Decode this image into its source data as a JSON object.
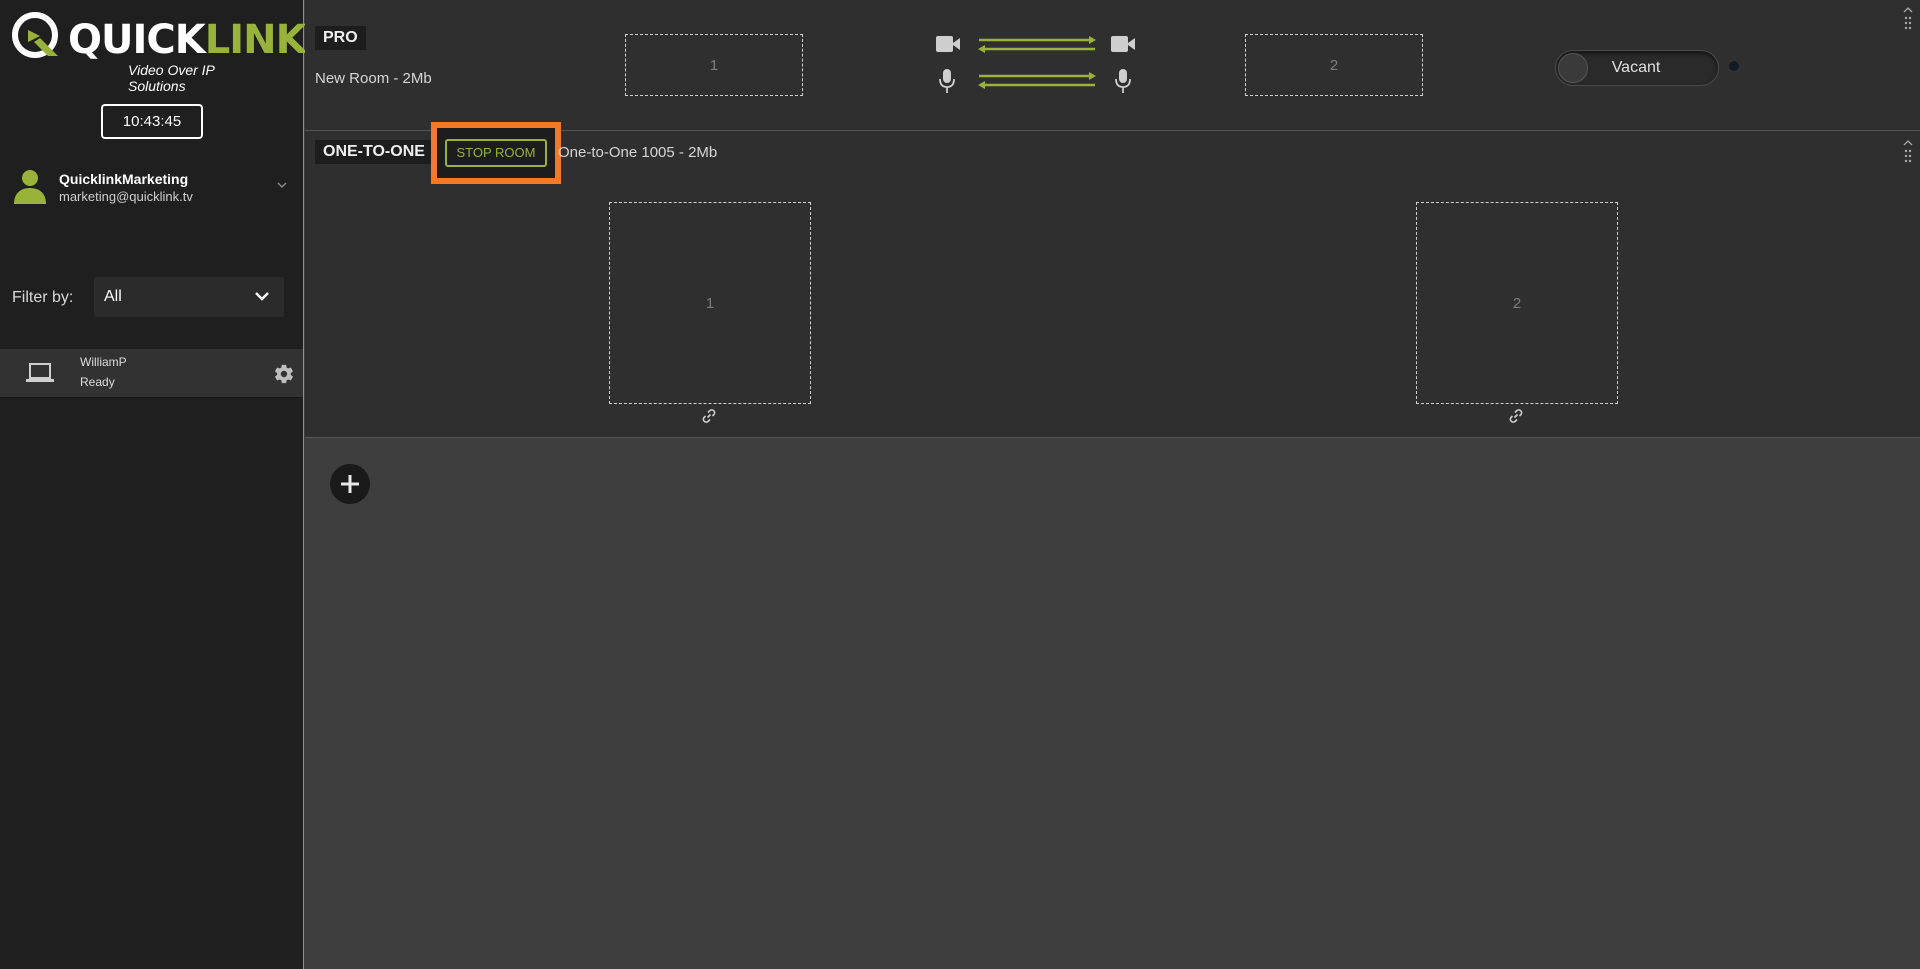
{
  "brand": {
    "name_part1": "QUICK",
    "name_part2": "LINK",
    "tagline": "Video Over IP Solutions",
    "accent_color": "#99b23a"
  },
  "clock": {
    "time": "10:43:45"
  },
  "user": {
    "name": "QuicklinkMarketing",
    "email": "marketing@quicklink.tv",
    "icon": "user-icon"
  },
  "filter": {
    "label": "Filter by:",
    "selected": "All"
  },
  "devices": [
    {
      "name": "WilliamP",
      "status": "Ready",
      "icon": "laptop-icon"
    }
  ],
  "rooms": {
    "pro": {
      "type": "PRO",
      "subtitle": "New Room - 2Mb",
      "slot1": "1",
      "slot2": "2",
      "status_toggle": "Vacant"
    },
    "one_to_one": {
      "type": "ONE-TO-ONE",
      "stop_label": "STOP ROOM",
      "subtitle": "One-to-One 1005 - 2Mb",
      "slot1": "1",
      "slot2": "2"
    }
  },
  "colors": {
    "highlight": "#f07a2b",
    "sidebar_bg": "#1f1f1f",
    "main_bg": "#3f3e3f",
    "room_bg": "#2f2f2f"
  }
}
